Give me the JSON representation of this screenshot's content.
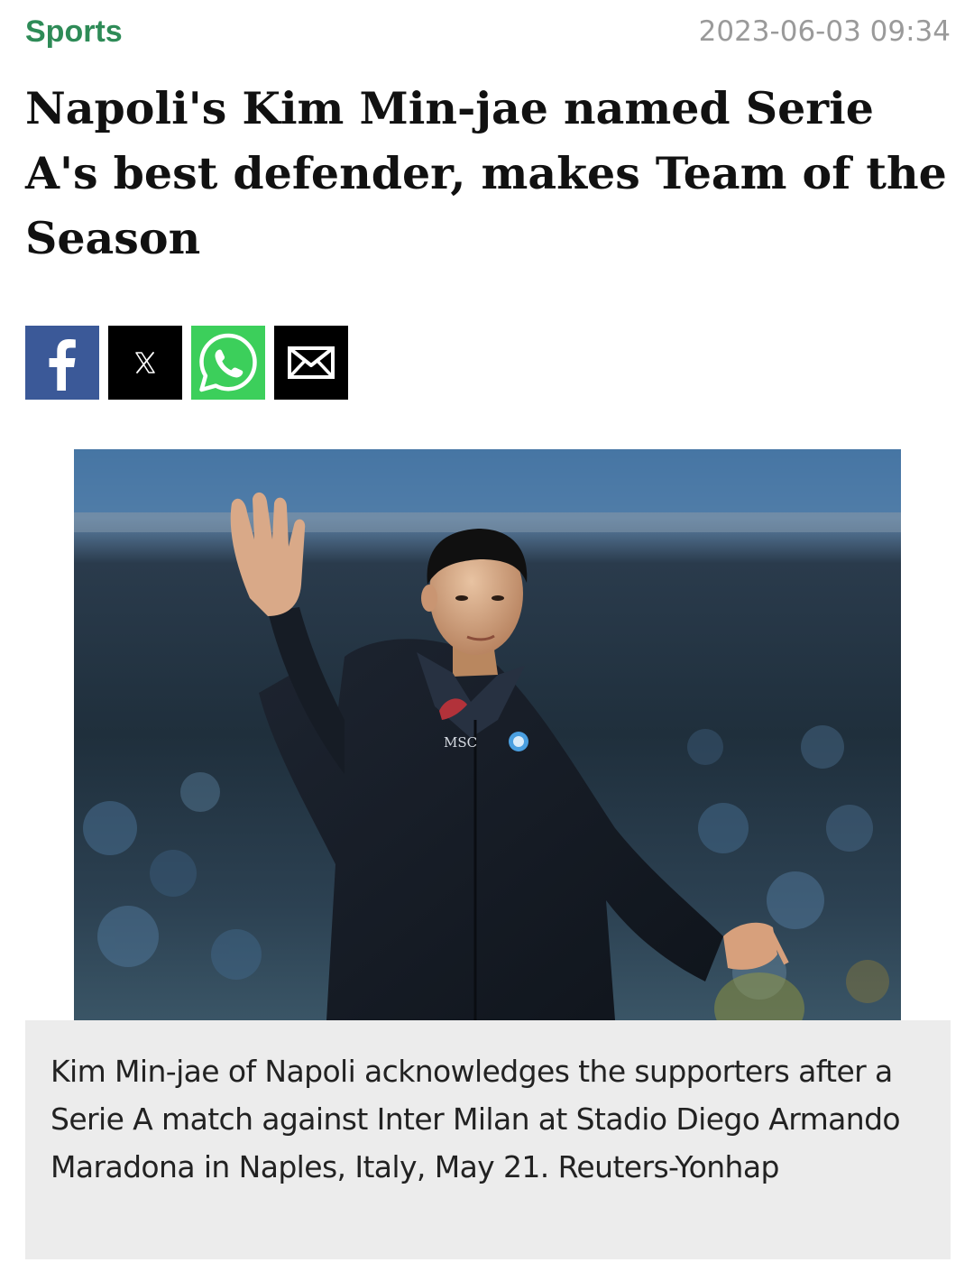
{
  "article": {
    "category": "Sports",
    "timestamp": "2023-06-03 09:34",
    "headline": "Napoli's Kim Min-jae named Serie A's best defender, makes Team of the Season",
    "caption": "Kim Min-jae of Napoli acknowledges the supporters after a Serie A match against Inter Milan at Stadio Diego Armando Maradona in Naples, Italy, May 21. Reuters-Yonhap"
  },
  "share": {
    "buttons": [
      {
        "icon": "facebook-icon",
        "color": "#3b5998"
      },
      {
        "icon": "x-icon",
        "color": "#000000"
      },
      {
        "icon": "whatsapp-icon",
        "color": "#3ccf5b"
      },
      {
        "icon": "mail-icon",
        "color": "#000000"
      }
    ]
  },
  "photo": {
    "jersey_text": "MSC"
  },
  "colors": {
    "category": "#2e8b57",
    "timestamp": "#9a9a9a",
    "caption_bg": "#ececec"
  }
}
